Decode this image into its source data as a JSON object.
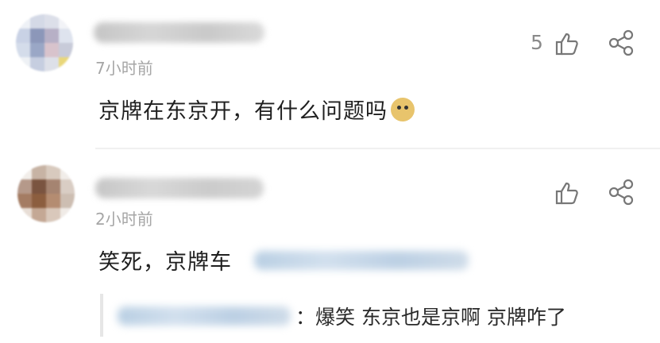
{
  "comments": [
    {
      "username": "",
      "time": "7小时前",
      "text": "京牌在东京开，有什么问题吗",
      "emoji": "doge-emoji",
      "likes": "5"
    },
    {
      "username": "",
      "time": "2小时前",
      "text": "笑死，京牌车",
      "likes": "",
      "reply": {
        "text": "：爆笑 东京也是京啊 京牌咋了"
      }
    }
  ],
  "icons": {
    "like": "thumbs-up-icon",
    "share": "share-icon"
  }
}
